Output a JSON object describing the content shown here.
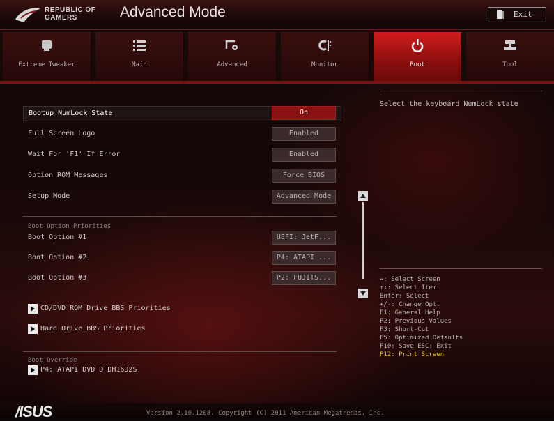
{
  "header": {
    "brand_line1": "REPUBLIC OF",
    "brand_line2": "GAMERS",
    "mode_title": "Advanced Mode",
    "exit_label": "Exit"
  },
  "tabs": [
    {
      "label": "Extreme Tweaker",
      "icon": "cpu-cooler-icon",
      "active": false
    },
    {
      "label": "Main",
      "icon": "list-icon",
      "active": false
    },
    {
      "label": "Advanced",
      "icon": "advanced-settings-icon",
      "active": false
    },
    {
      "label": "Monitor",
      "icon": "monitor-gauge-icon",
      "active": false
    },
    {
      "label": "Boot",
      "icon": "power-icon",
      "active": true
    },
    {
      "label": "Tool",
      "icon": "tool-icon",
      "active": false
    }
  ],
  "settings": [
    {
      "label": "Bootup NumLock State",
      "value": "On",
      "selected": true
    },
    {
      "label": "Full Screen Logo",
      "value": "Enabled"
    },
    {
      "label": "Wait For 'F1' If Error",
      "value": "Enabled"
    },
    {
      "label": "Option ROM Messages",
      "value": "Force BIOS"
    },
    {
      "label": "Setup Mode",
      "value": "Advanced Mode"
    }
  ],
  "boot_priorities": {
    "section_title": "Boot Option Priorities",
    "options": [
      {
        "label": "Boot Option #1",
        "value": "UEFI: JetF..."
      },
      {
        "label": "Boot Option #2",
        "value": "P4: ATAPI ..."
      },
      {
        "label": "Boot Option #3",
        "value": "P2: FUJITS..."
      }
    ]
  },
  "sublinks": [
    {
      "label": "CD/DVD ROM Drive BBS Priorities"
    },
    {
      "label": "Hard Drive BBS Priorities"
    }
  ],
  "boot_override": {
    "section_title": "Boot Override",
    "item": "P4: ATAPI   DVD D  DH16D2S"
  },
  "help": {
    "description": "Select the keyboard NumLock state",
    "keys": [
      "↔: Select Screen",
      "↑↓: Select Item",
      "Enter: Select",
      "+/-: Change Opt.",
      "F1: General Help",
      "F2: Previous Values",
      "F3: Short-Cut",
      "F5: Optimized Defaults",
      "F10: Save  ESC: Exit"
    ],
    "highlight_key": "F12: Print Screen"
  },
  "footer": {
    "asus_logo": "/ISUS",
    "version": "Version 2.10.1208. Copyright (C) 2011 American Megatrends, Inc."
  },
  "colors": {
    "accent_red": "#d11c1c",
    "value_on": "#8a1212",
    "highlight_yellow": "#e6c020"
  }
}
